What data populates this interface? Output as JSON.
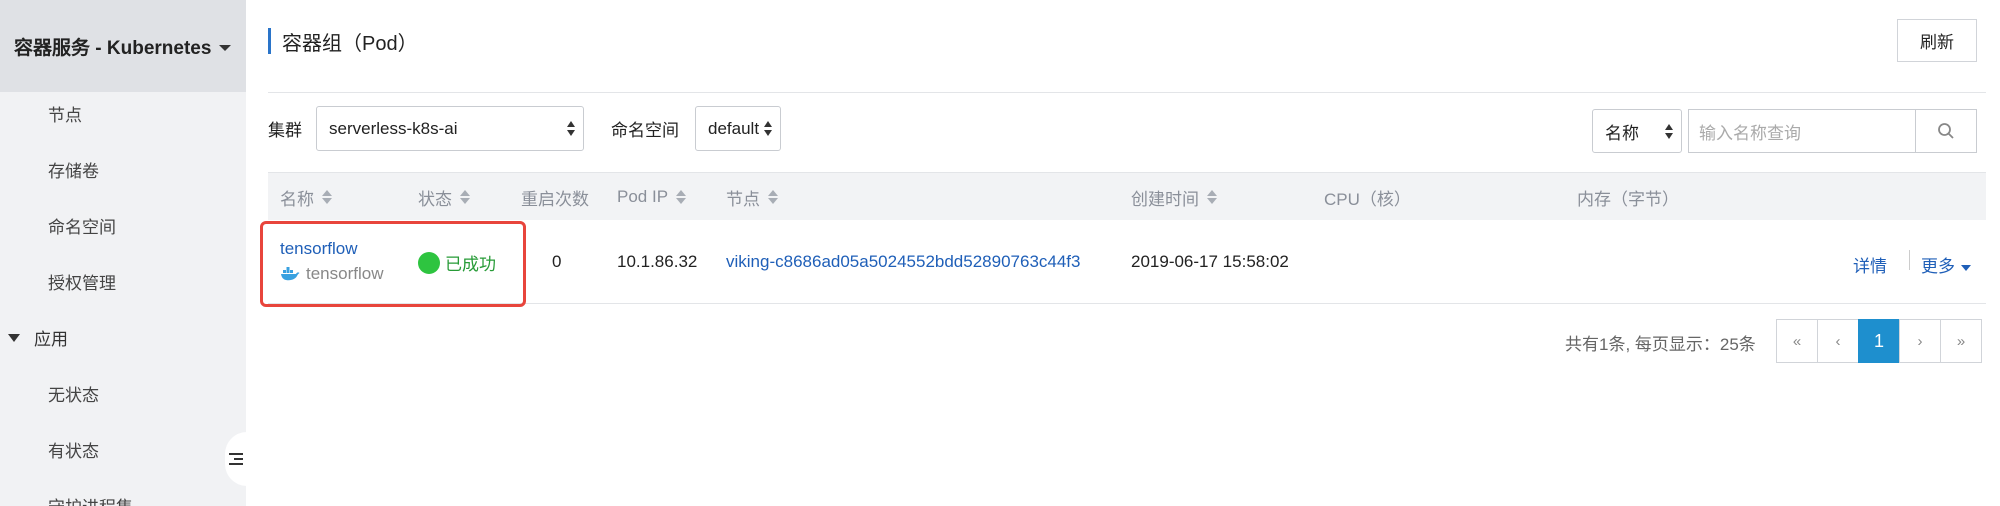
{
  "sidebar": {
    "header": "容器服务 - Kubernetes",
    "items": [
      {
        "label": "节点"
      },
      {
        "label": "存储卷"
      },
      {
        "label": "命名空间"
      },
      {
        "label": "授权管理"
      }
    ],
    "group": "应用",
    "group_items": [
      {
        "label": "无状态"
      },
      {
        "label": "有状态"
      },
      {
        "label": "守护进程集"
      }
    ]
  },
  "page": {
    "title": "容器组（Pod）",
    "refresh_label": "刷新"
  },
  "filters": {
    "cluster_label": "集群",
    "cluster_value": "serverless-k8s-ai",
    "namespace_label": "命名空间",
    "namespace_value": "default",
    "search_field_value": "名称",
    "search_placeholder": "输入名称查询"
  },
  "table": {
    "columns": [
      "名称",
      "状态",
      "重启次数",
      "Pod IP",
      "节点",
      "创建时间",
      "CPU（核）",
      "内存（字节）"
    ],
    "rows": [
      {
        "name": "tensorflow",
        "image": "tensorflow",
        "status": "已成功",
        "restarts": "0",
        "pod_ip": "10.1.86.32",
        "node": "viking-c8686ad05a5024552bdd52890763c44f3",
        "created": "2019-06-17 15:58:02",
        "cpu": "",
        "memory": "",
        "actions": {
          "detail": "详情",
          "more": "更多"
        }
      }
    ]
  },
  "pagination": {
    "summary": "共有1条, 每页显示：25条",
    "first": "«",
    "prev": "‹",
    "current": "1",
    "next": "›",
    "last": "»"
  },
  "colors": {
    "accent": "#1e8fce",
    "link": "#1f5fb8",
    "success": "#2ec440",
    "highlight": "#e8453c"
  }
}
